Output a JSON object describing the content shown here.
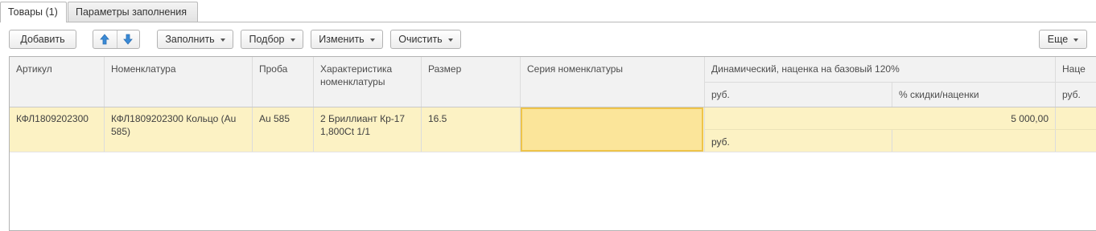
{
  "tabs": [
    {
      "label": "Товары (1)",
      "active": true
    },
    {
      "label": "Параметры заполнения",
      "active": false
    }
  ],
  "toolbar": {
    "add": "Добавить",
    "move_up_icon": "arrow-up-icon",
    "move_down_icon": "arrow-down-icon",
    "fill": "Заполнить",
    "select": "Подбор",
    "change": "Изменить",
    "clear": "Очистить",
    "more": "Еще"
  },
  "grid": {
    "columns": {
      "article": "Артикул",
      "nomenclature": "Номенклатура",
      "probe": "Проба",
      "characteristic": "Характеристика номенклатуры",
      "size": "Размер",
      "series": "Серия номенклатуры",
      "dynamic": "Динамический, наценка на базовый 120%",
      "dynamic_rub": "руб.",
      "dynamic_discount": "% скидки/наценки",
      "next": "Наце",
      "next_rub": "руб."
    },
    "rows": [
      {
        "article": "КФЛ1809202300",
        "nomenclature": "КФЛ1809202300 Кольцо (Au 585)",
        "probe": "Au 585",
        "characteristic": "2 Бриллиант Кр-17 1,800Ct 1/1",
        "size": "16.5",
        "series": "",
        "dynamic_price": "5 000,00",
        "dynamic_currency": "руб."
      }
    ]
  },
  "colors": {
    "selected_row": "#fcf2c4",
    "selected_cell": "#fbe59a",
    "arrow_blue": "#3a8ad6"
  }
}
